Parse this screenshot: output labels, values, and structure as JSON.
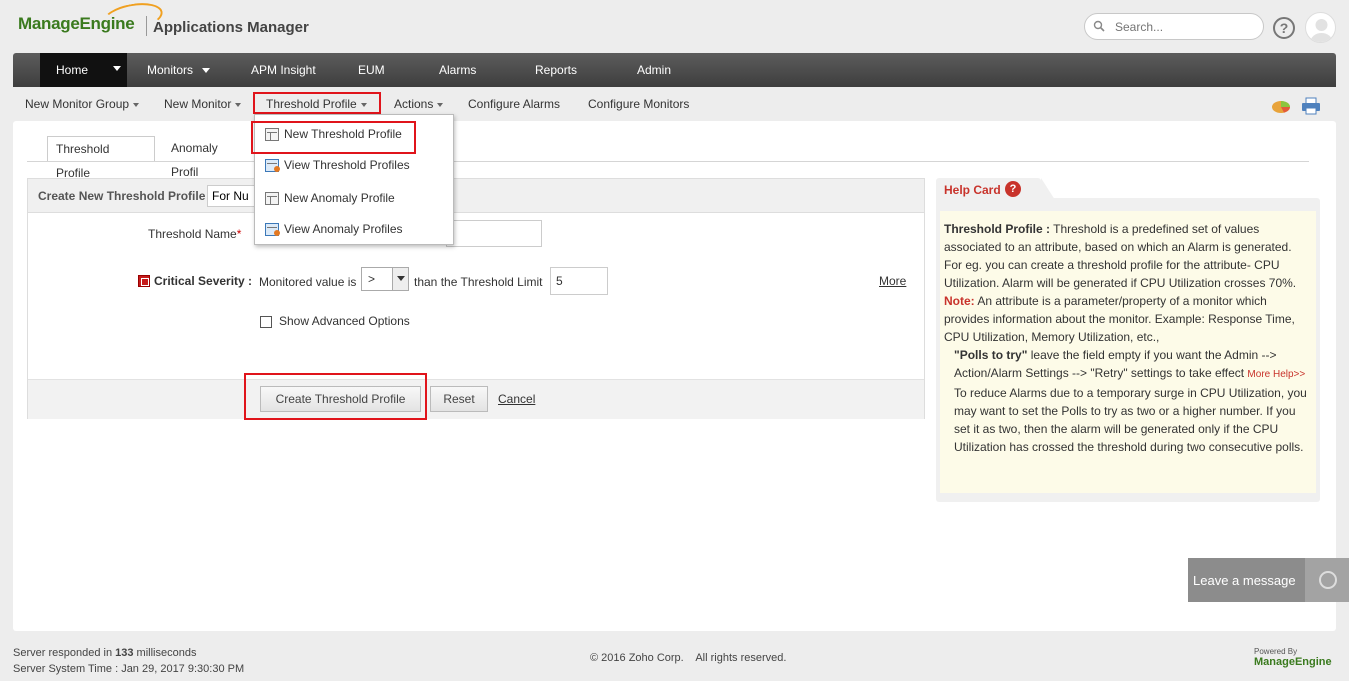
{
  "header": {
    "logo": "ManageEngine",
    "app_name": "Applications Manager",
    "search_placeholder": "Search...",
    "help_label": "?"
  },
  "main_nav": {
    "home": "Home",
    "monitors": "Monitors",
    "apm_insight": "APM Insight",
    "eum": "EUM",
    "alarms": "Alarms",
    "reports": "Reports",
    "admin": "Admin"
  },
  "sub_nav": {
    "new_monitor_group": "New Monitor Group",
    "new_monitor": "New Monitor",
    "threshold_profile": "Threshold Profile",
    "actions": "Actions",
    "configure_alarms": "Configure Alarms",
    "configure_monitors": "Configure Monitors"
  },
  "dropdown": {
    "items": [
      {
        "label": "New Threshold Profile",
        "icon": "new-profile-icon"
      },
      {
        "label": "View Threshold Profiles",
        "icon": "view-profiles-icon"
      },
      {
        "label": "New Anomaly Profile",
        "icon": "new-profile-icon"
      },
      {
        "label": "View Anomaly Profiles",
        "icon": "view-profiles-icon"
      }
    ]
  },
  "tabs": {
    "threshold_profile": "Threshold Profile",
    "anomaly_profile": "Anomaly Profil"
  },
  "form": {
    "header_label": "Create New Threshold Profile",
    "type_select": "For Nu",
    "threshold_name_label": "Threshold Name",
    "required_mark": "*",
    "critical_label": "Critical Severity :",
    "monitored_value_label": "Monitored value is",
    "condition": ">",
    "than_label": "than the Threshold Limit",
    "limit_value": "5",
    "more_link": "More",
    "advanced_label": "Show Advanced Options",
    "create_button": "Create  Threshold Profile",
    "reset_button": "Reset",
    "cancel_link": "Cancel"
  },
  "help_card": {
    "title": "Help Card",
    "q": "?",
    "p1_bold": "Threshold Profile :",
    "p1": " Threshold is a predefined set of values associated to an attribute, based on which an Alarm is generated. For eg. you can create a threshold profile for the attribute- CPU Utilization. Alarm will be generated if CPU Utilization crosses 70%.",
    "note_label": "Note:",
    "note": " An attribute is a parameter/property of a monitor which provides information about the monitor. Example: Response Time, CPU Utilization, Memory Utilization, etc.,",
    "polls_bold": "\"Polls to try\"",
    "polls": " leave the field empty if you want the Admin --> Action/Alarm Settings --> \"Retry\" settings to take effect ",
    "more_help": "More Help>>",
    "reduce": "To reduce Alarms due to a temporary surge in CPU Utilization, you may want to set the Polls to try as two or a higher number. If you set it as two, then the alarm will be generated only if the CPU Utilization has crossed the threshold during two consecutive polls."
  },
  "chat": {
    "label": "Leave a message"
  },
  "footer": {
    "response_prefix": "Server responded in ",
    "response_ms": "133",
    "response_suffix": " milliseconds",
    "server_time": "Server System Time : Jan 29, 2017 9:30:30 PM",
    "copyright": "© 2016 Zoho Corp.    All rights reserved.",
    "powered_by": "Powered By",
    "powered_logo": "ManageEngine"
  },
  "colors": {
    "highlight": "#e0141b",
    "brand_green": "#3a7a1e",
    "help_red": "#c8332b"
  }
}
